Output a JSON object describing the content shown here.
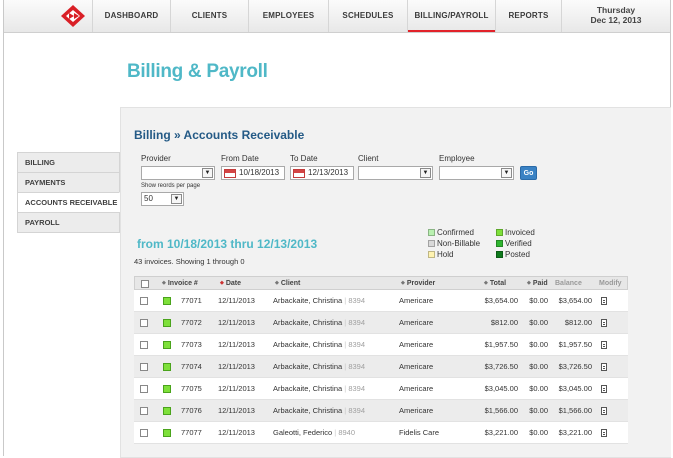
{
  "nav": {
    "items": [
      "DASHBOARD",
      "CLIENTS",
      "EMPLOYEES",
      "SCHEDULES",
      "BILLING/PAYROLL",
      "REPORTS"
    ],
    "active_index": 4,
    "day": "Thursday",
    "date": "Dec 12, 2013",
    "accent_color": "#e2222a"
  },
  "page": {
    "title": "Billing & Payroll",
    "breadcrumb": "Billing » Accounts Receivable"
  },
  "sidebar": {
    "items": [
      "BILLING",
      "PAYMENTS",
      "ACCOUNTS RECEIVABLE",
      "PAYROLL"
    ],
    "active_index": 2
  },
  "filters": {
    "provider_label": "Provider",
    "provider_value": "",
    "from_date_label": "From Date",
    "from_date_value": "10/18/2013",
    "to_date_label": "To Date",
    "to_date_value": "12/13/2013",
    "client_label": "Client",
    "client_value": "",
    "employee_label": "Employee",
    "employee_value": "",
    "go_label": "Go",
    "per_page_label": "Show reords per page",
    "per_page_value": "50"
  },
  "range": {
    "title": "from 10/18/2013 thru 12/13/2013",
    "summary": "43 invoices. Showing 1 through 0"
  },
  "legend": [
    {
      "label": "Confirmed",
      "color": "#b9f0b0"
    },
    {
      "label": "Non-Billable",
      "color": "#d9d9d9"
    },
    {
      "label": "Hold",
      "color": "#fff3b0"
    },
    {
      "label": "Invoiced",
      "color": "#7ee03a"
    },
    {
      "label": "Verified",
      "color": "#2fb52f"
    },
    {
      "label": "Posted",
      "color": "#0f7a1c"
    }
  ],
  "table": {
    "columns": [
      "Invoice #",
      "Date",
      "Client",
      "Provider",
      "Total",
      "Paid",
      "Balance",
      "Modify"
    ],
    "rows": [
      {
        "invoice": "77071",
        "date": "12/11/2013",
        "client": "Arbackaite, Christina",
        "client_id": "8394",
        "provider": "Americare",
        "total": "$3,654.00",
        "paid": "$0.00",
        "balance": "$3,654.00"
      },
      {
        "invoice": "77072",
        "date": "12/11/2013",
        "client": "Arbackaite, Christina",
        "client_id": "8394",
        "provider": "Americare",
        "total": "$812.00",
        "paid": "$0.00",
        "balance": "$812.00"
      },
      {
        "invoice": "77073",
        "date": "12/11/2013",
        "client": "Arbackaite, Christina",
        "client_id": "8394",
        "provider": "Americare",
        "total": "$1,957.50",
        "paid": "$0.00",
        "balance": "$1,957.50"
      },
      {
        "invoice": "77074",
        "date": "12/11/2013",
        "client": "Arbackaite, Christina",
        "client_id": "8394",
        "provider": "Americare",
        "total": "$3,726.50",
        "paid": "$0.00",
        "balance": "$3,726.50"
      },
      {
        "invoice": "77075",
        "date": "12/11/2013",
        "client": "Arbackaite, Christina",
        "client_id": "8394",
        "provider": "Americare",
        "total": "$3,045.00",
        "paid": "$0.00",
        "balance": "$3,045.00"
      },
      {
        "invoice": "77076",
        "date": "12/11/2013",
        "client": "Arbackaite, Christina",
        "client_id": "8394",
        "provider": "Americare",
        "total": "$1,566.00",
        "paid": "$0.00",
        "balance": "$1,566.00"
      },
      {
        "invoice": "77077",
        "date": "12/11/2013",
        "client": "Galeotti, Federico",
        "client_id": "8940",
        "provider": "Fidelis Care",
        "total": "$3,221.00",
        "paid": "$0.00",
        "balance": "$3,221.00"
      }
    ]
  }
}
